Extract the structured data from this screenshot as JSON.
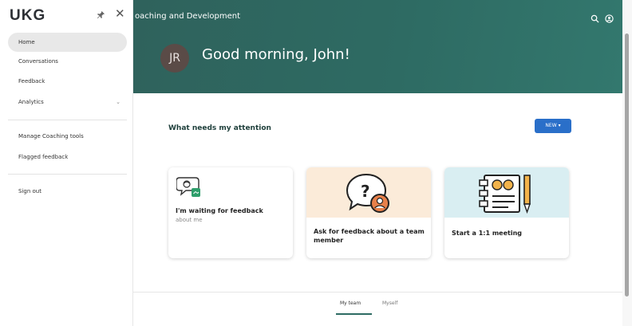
{
  "sidebar": {
    "logo": "UKG",
    "items": [
      {
        "label": "Home"
      },
      {
        "label": "Conversations"
      },
      {
        "label": "Feedback"
      },
      {
        "label": "Analytics"
      },
      {
        "label": "Manage Coaching tools"
      },
      {
        "label": "Flagged feedback"
      },
      {
        "label": "Sign out"
      }
    ]
  },
  "header": {
    "title": "oaching and Development",
    "avatar_initials": "JR",
    "greeting": "Good morning, John!"
  },
  "main": {
    "section_title": "What needs my attention",
    "new_button": "NEW",
    "cards": [
      {
        "label": "I'm waiting for feedback",
        "sub": "about me"
      },
      {
        "label": "Ask for feedback about a team member"
      },
      {
        "label": "Start a 1:1 meeting"
      }
    ],
    "tabs": [
      {
        "label": "My team"
      },
      {
        "label": "Myself"
      }
    ]
  },
  "colors": {
    "header": "#2e6b63",
    "button": "#2a6fc9",
    "card2_bg": "#fbebd9",
    "card3_bg": "#d9eef2"
  }
}
